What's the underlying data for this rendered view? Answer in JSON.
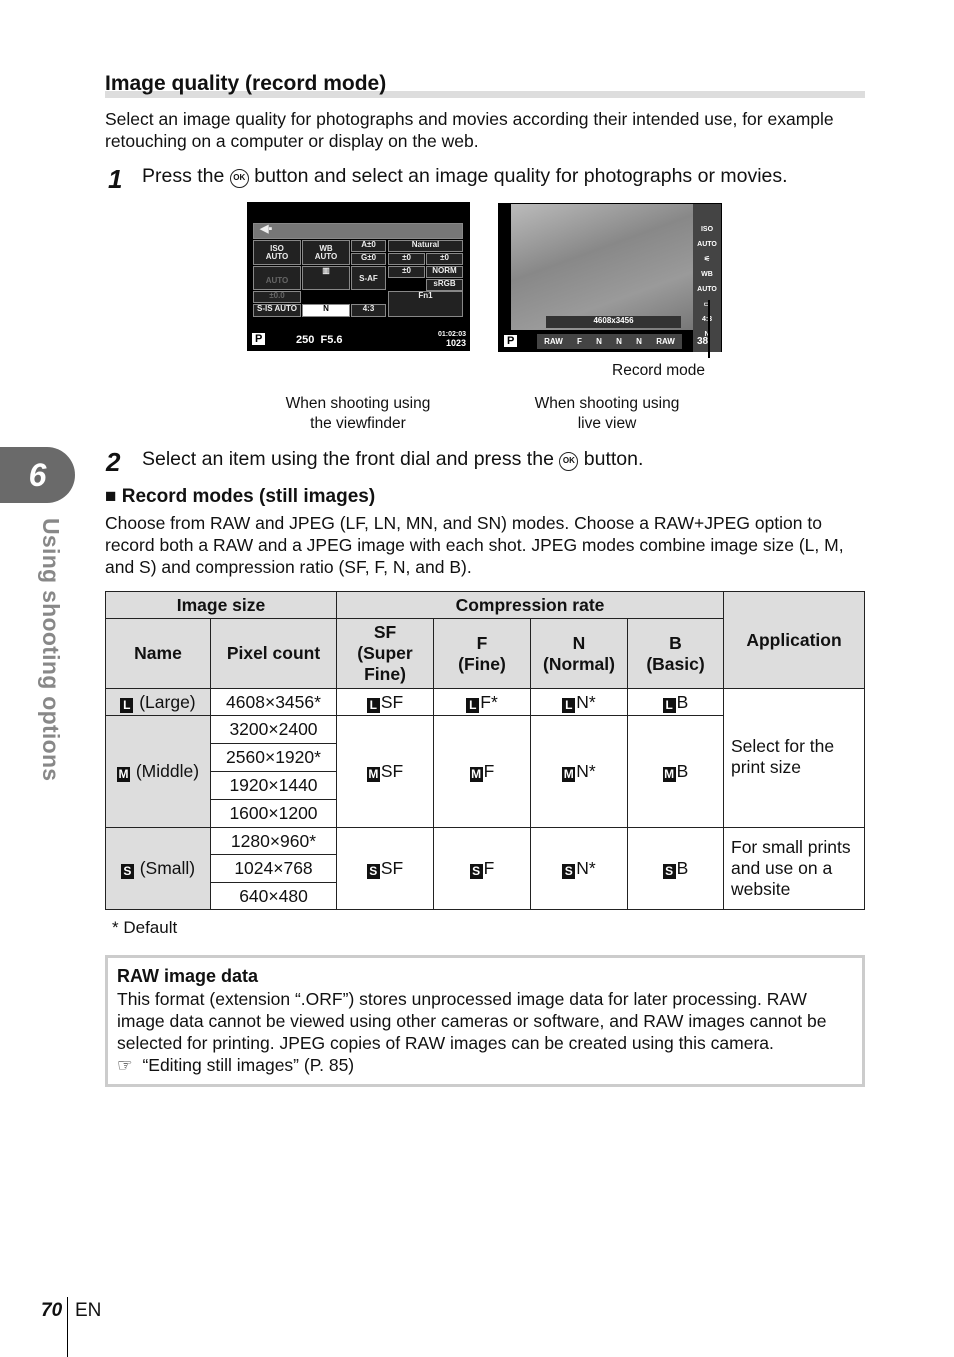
{
  "section": {
    "title": "Image quality (record mode)",
    "intro": "Select an image quality for photographs and movies according their intended use, for example retouching on a computer or display on the web."
  },
  "step1": {
    "num": "1",
    "pre": "Press the",
    "ok": "OK",
    "post": "button and select an image quality for photographs or movies."
  },
  "viewfinder_screen": {
    "iso": "ISO",
    "iso_v": "AUTO",
    "wb": "WB",
    "wb_v": "AUTO",
    "a": "A±0",
    "g": "G±0",
    "pic": "Natural",
    "sharp": "±0",
    "contrast": "±0",
    "sat": "±0",
    "grad": "NORM",
    "flash": "AUTO",
    "af": "S-AF",
    "cs": "sRGB",
    "flashcomp": "±0.0",
    "is": "S-IS AUTO",
    "quality": "N",
    "aspect": "4:3",
    "fn": "Fn1",
    "mode": "P",
    "shutter": "250",
    "aperture": "F5.6",
    "time": "01:02:03",
    "shots": "1023"
  },
  "liveview_screen": {
    "size": "4608x3456",
    "mode": "P",
    "items": [
      "RAW",
      "F",
      "N",
      "N",
      "N",
      "RAW"
    ],
    "side": [
      "ISO AUTO",
      "WB AUTO",
      "4:3",
      "N"
    ],
    "count": "38"
  },
  "captions": {
    "record_mode": "Record mode",
    "viewfinder": "When shooting using\nthe viewfinder",
    "liveview": "When shooting using\nlive view"
  },
  "step2": {
    "num": "2",
    "pre": "Select an item using the front dial and press the",
    "ok": "OK",
    "post": "button."
  },
  "record": {
    "heading": "Record modes (still images)",
    "text": "Choose from RAW and JPEG (LF, LN, MN, and SN) modes. Choose a RAW+JPEG option to record both a RAW and a JPEG image with each shot. JPEG modes combine image size (L, M, and S) and compression ratio (SF, F, N, and B)."
  },
  "table": {
    "h_size": "Image size",
    "h_comp": "Compression rate",
    "h_app": "Application",
    "h_name": "Name",
    "h_pixel": "Pixel count",
    "h_sf": "SF\n(Super\nFine)",
    "h_f": "F\n(Fine)",
    "h_n": "N\n(Normal)",
    "h_b": "B\n(Basic)",
    "rows": [
      {
        "icon": "L",
        "name": "(Large)",
        "pixels": [
          "4608×3456*"
        ],
        "sf": "SF",
        "f": "F*",
        "n": "N*",
        "b": "B"
      },
      {
        "icon": "M",
        "name": "(Middle)",
        "pixels": [
          "3200×2400",
          "2560×1920*",
          "1920×1440",
          "1600×1200"
        ],
        "sf": "SF",
        "f": "F",
        "n": "N*",
        "b": "B"
      },
      {
        "icon": "S",
        "name": "(Small)",
        "pixels": [
          "1280×960*",
          "1024×768",
          "640×480"
        ],
        "sf": "SF",
        "f": "F",
        "n": "N*",
        "b": "B"
      }
    ],
    "app_print": "Select for the print size",
    "app_web": "For small prints and use on a website"
  },
  "footnote": "*  Default",
  "raw_box": {
    "title": "RAW image data",
    "text": "This format (extension “.ORF”) stores unprocessed image data for later processing. RAW image data cannot be viewed using other cameras or software, and RAW images cannot be selected for printing. JPEG copies of RAW images can be created using this camera.",
    "ref": "“Editing still images” (P. 85)"
  },
  "side_tab": {
    "chapter": "6",
    "label": "Using shooting options"
  },
  "footer": {
    "page": "70",
    "lang": "EN"
  }
}
